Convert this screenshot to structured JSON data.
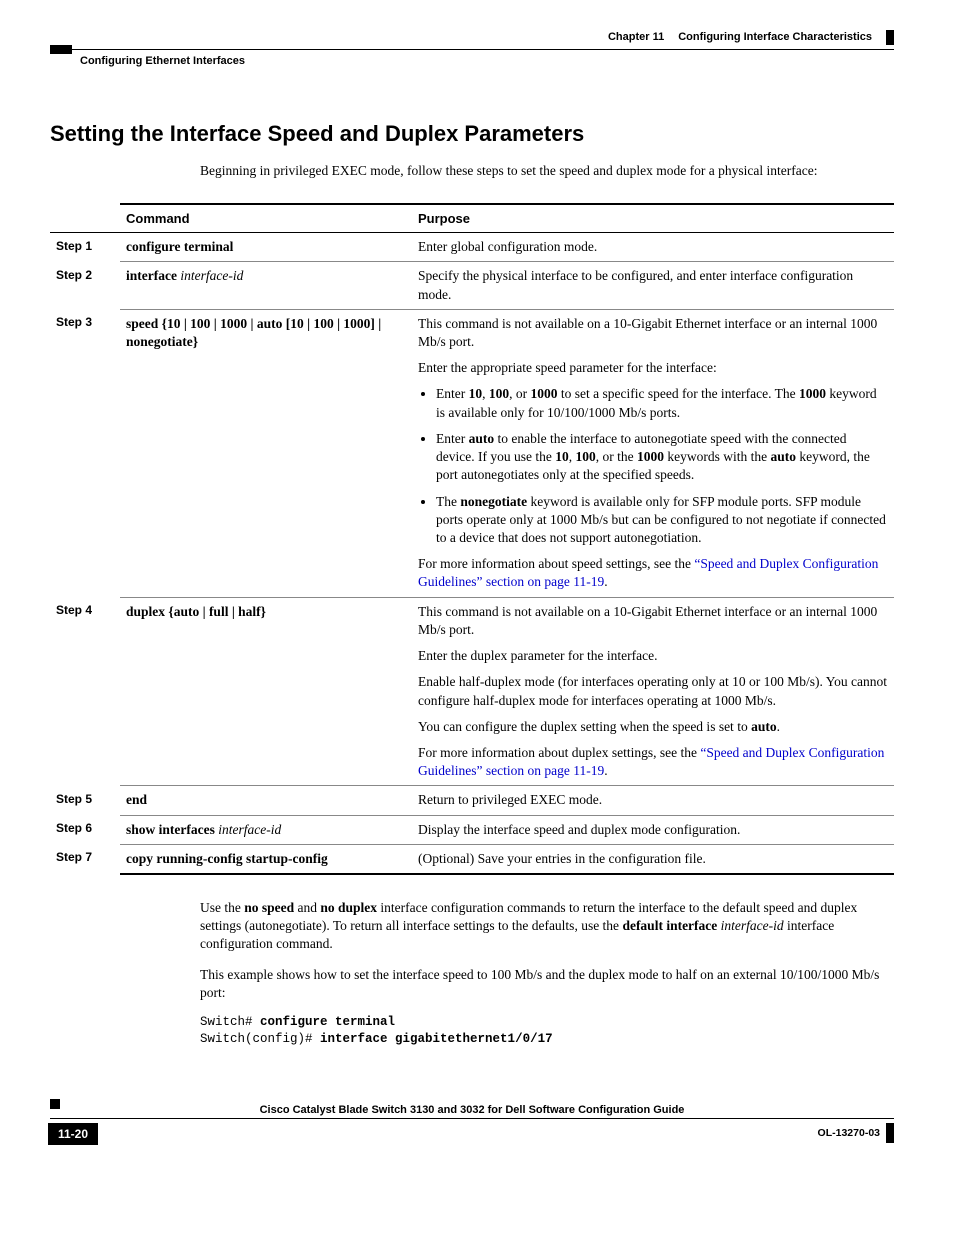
{
  "header": {
    "chapter": "Chapter 11",
    "chapterTitle": "Configuring Interface Characteristics",
    "subsection": "Configuring Ethernet Interfaces"
  },
  "title": "Setting the Interface Speed and Duplex Parameters",
  "intro": "Beginning in privileged EXEC mode, follow these steps to set the speed and duplex mode for a physical interface:",
  "table": {
    "head": {
      "command": "Command",
      "purpose": "Purpose"
    },
    "steps": {
      "s1": {
        "label": "Step 1",
        "cmd_b": "configure terminal",
        "purpose": "Enter global configuration mode."
      },
      "s2": {
        "label": "Step 2",
        "cmd_b": "interface",
        "cmd_i": "interface-id",
        "purpose": "Specify the physical interface to be configured, and enter interface configuration mode."
      },
      "s3": {
        "label": "Step 3",
        "cmd_full": "speed {10 | 100 | 1000 | auto [10 | 100 | 1000] | nonegotiate}",
        "p1": "This command is not available on a 10-Gigabit Ethernet interface or an internal 1000 Mb/s port.",
        "p2": "Enter the appropriate speed parameter for the interface:",
        "b1_pre": "Enter ",
        "b1_k1": "10",
        "b1_mid1": ", ",
        "b1_k2": "100",
        "b1_mid2": ", or ",
        "b1_k3": "1000",
        "b1_post": " to set a specific speed for the interface. The ",
        "b1_k4": "1000",
        "b1_end": " keyword is available only for 10/100/1000 Mb/s ports.",
        "b2_pre": "Enter ",
        "b2_k1": "auto",
        "b2_mid1": " to enable the interface to autonegotiate speed with the connected device. If you use the ",
        "b2_k2": "10",
        "b2_mid2": ", ",
        "b2_k3": "100",
        "b2_mid3": ", or the ",
        "b2_k4": "1000",
        "b2_mid4": " keywords with the ",
        "b2_k5": "auto",
        "b2_end": " keyword, the port autonegotiates only at the specified speeds.",
        "b3_pre": "The ",
        "b3_k1": "nonegotiate",
        "b3_end": " keyword is available only for SFP module ports. SFP module ports operate only at 1000 Mb/s but can be configured to not negotiate if connected to a device that does not support autonegotiation.",
        "more_pre": "For more information about speed settings, see the ",
        "more_link": "“Speed and Duplex Configuration Guidelines” section on page 11-19",
        "more_post": "."
      },
      "s4": {
        "label": "Step 4",
        "cmd_full": "duplex {auto | full | half}",
        "p1": "This command is not available on a 10-Gigabit Ethernet interface or an internal 1000 Mb/s port.",
        "p2": "Enter the duplex parameter for the interface.",
        "p3": "Enable half-duplex mode (for interfaces operating only at 10 or 100 Mb/s). You cannot configure half-duplex mode for interfaces operating at 1000 Mb/s.",
        "p4_pre": "You can configure the duplex setting when the speed is set to ",
        "p4_k": "auto",
        "p4_post": ".",
        "more_pre": "For more information about duplex settings, see the ",
        "more_link": "“Speed and Duplex Configuration Guidelines” section on page 11-19",
        "more_post": "."
      },
      "s5": {
        "label": "Step 5",
        "cmd_b": "end",
        "purpose": "Return to privileged EXEC mode."
      },
      "s6": {
        "label": "Step 6",
        "cmd_b": "show interfaces",
        "cmd_i": "interface-id",
        "purpose": "Display the interface speed and duplex mode configuration."
      },
      "s7": {
        "label": "Step 7",
        "cmd_b": "copy running-config startup-config",
        "purpose": "(Optional) Save your entries in the configuration file."
      }
    }
  },
  "after": {
    "p1_pre": "Use the ",
    "p1_k1": "no speed",
    "p1_mid1": " and ",
    "p1_k2": "no duplex",
    "p1_mid2": " interface configuration commands to return the interface to the default speed and duplex settings (autonegotiate). To return all interface settings to the defaults, use the ",
    "p1_k3": "default interface",
    "p1_i": "interface-id",
    "p1_end": " interface configuration command.",
    "p2": "This example shows how to set the interface speed to 100 Mb/s and the duplex mode to half on an external 10/100/1000 Mb/s port:"
  },
  "code": {
    "l1a": "Switch# ",
    "l1b": "configure terminal",
    "l2a": "Switch(config)# ",
    "l2b": "interface gigabitethernet1/0/17"
  },
  "footer": {
    "guide": "Cisco Catalyst Blade Switch 3130 and 3032 for Dell Software Configuration Guide",
    "page": "11-20",
    "docnum": "OL-13270-03"
  }
}
